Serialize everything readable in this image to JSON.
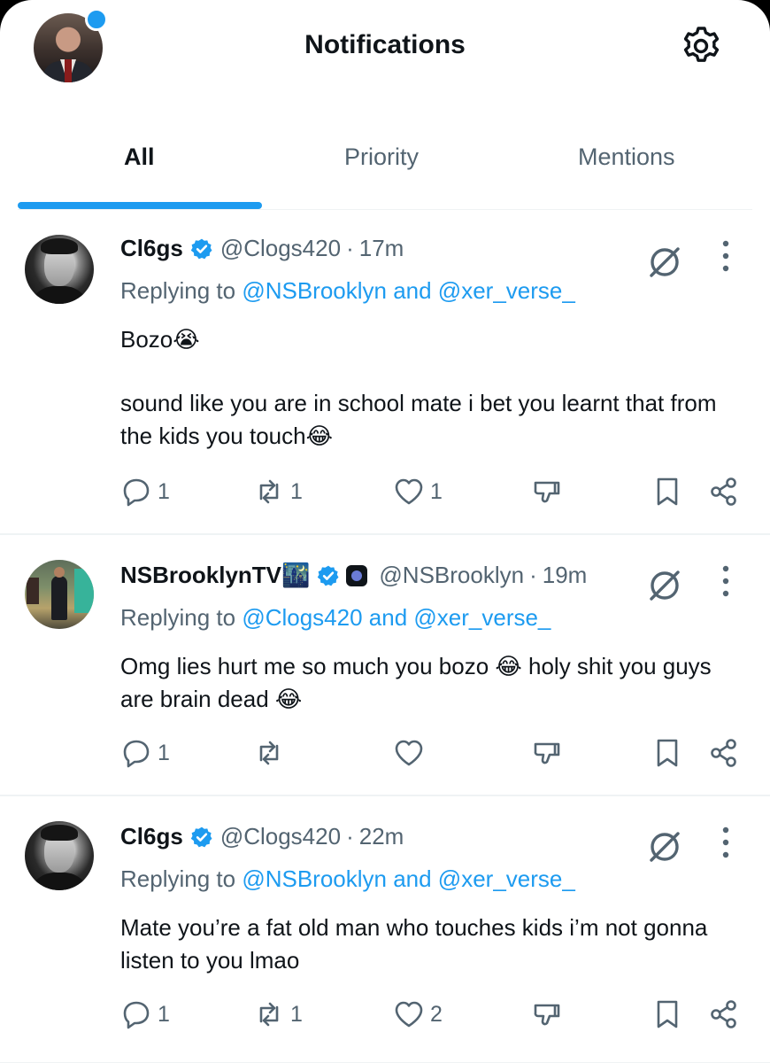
{
  "header": {
    "title": "Notifications",
    "has_unread_dot": true
  },
  "tabs": [
    {
      "label": "All",
      "active": true
    },
    {
      "label": "Priority",
      "active": false
    },
    {
      "label": "Mentions",
      "active": false
    }
  ],
  "colors": {
    "accent": "#1d9bf0",
    "text": "#0f1419",
    "muted": "#536471",
    "divider": "#eff3f4"
  },
  "posts": [
    {
      "display_name": "Cl6gs",
      "verified": true,
      "handle": "@Clogs420",
      "separator": "·",
      "time": "17m",
      "replying_prefix": "Replying to ",
      "replying_to": "@NSBrooklyn and @xer_verse_",
      "body_1": "Bozo😭",
      "body_2": "sound like you are in school mate i bet you learnt that from the kids you touch😂",
      "replies": "1",
      "reposts": "1",
      "likes": "1"
    },
    {
      "display_name": "NSBrooklynTV🌃",
      "verified": true,
      "extra_badge": "🔵",
      "handle": "@NSBrooklyn",
      "separator": "·",
      "time": "19m",
      "replying_prefix": "Replying to ",
      "replying_to": "@Clogs420 and @xer_verse_",
      "body_1": "Omg lies hurt me so much you bozo 😂 holy shit you guys are brain dead 😂",
      "replies": "1",
      "reposts": "",
      "likes": ""
    },
    {
      "display_name": "Cl6gs",
      "verified": true,
      "handle": "@Clogs420",
      "separator": "·",
      "time": "22m",
      "replying_prefix": "Replying to ",
      "replying_to": "@NSBrooklyn and @xer_verse_",
      "body_1": "Mate you’re a fat old man who touches kids i’m not gonna listen to you lmao",
      "replies": "1",
      "reposts": "1",
      "likes": "2"
    }
  ]
}
